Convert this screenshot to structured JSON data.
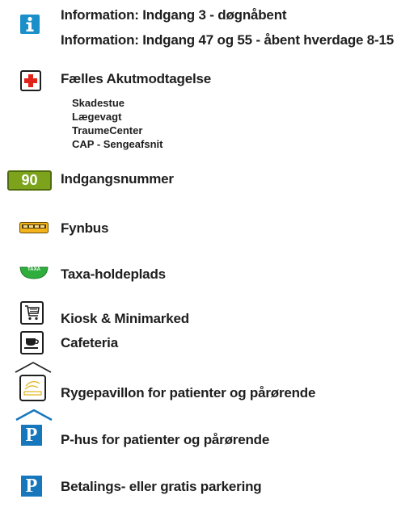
{
  "legend": {
    "information": {
      "line1": "Information: Indgang 3 - døgnåbent",
      "line2": "Information: Indgang 47 og 55 - åbent hverdage 8-15"
    },
    "emergency": {
      "title": "Fælles Akutmodtagelse",
      "sub_items": [
        "Skadestue",
        "Lægevagt",
        "TraumeCenter",
        "CAP - Sengeafsnit"
      ]
    },
    "entrance": {
      "badge": "90",
      "label": "Indgangsnummer"
    },
    "bus": {
      "label": "Fynbus"
    },
    "taxi": {
      "badge": "TAXA",
      "label": "Taxa-holdeplads"
    },
    "kiosk": {
      "label": "Kiosk & Minimarked"
    },
    "cafeteria": {
      "label": "Cafeteria"
    },
    "smoking": {
      "label": "Rygepavillon for patienter og pårørende"
    },
    "parking_garage": {
      "badge": "P",
      "label": "P-hus for patienter og pårørende"
    },
    "parking": {
      "badge": "P",
      "label": "Betalings- eller gratis parkering"
    }
  },
  "colors": {
    "info_blue": "#1a8fc9",
    "emergency_red": "#e2231a",
    "entrance_green": "#7da31c",
    "bus_yellow": "#f3b41b",
    "taxi_green": "#2fae3d",
    "parking_blue": "#1677bd",
    "smoking_yellow": "#e4b82a"
  }
}
